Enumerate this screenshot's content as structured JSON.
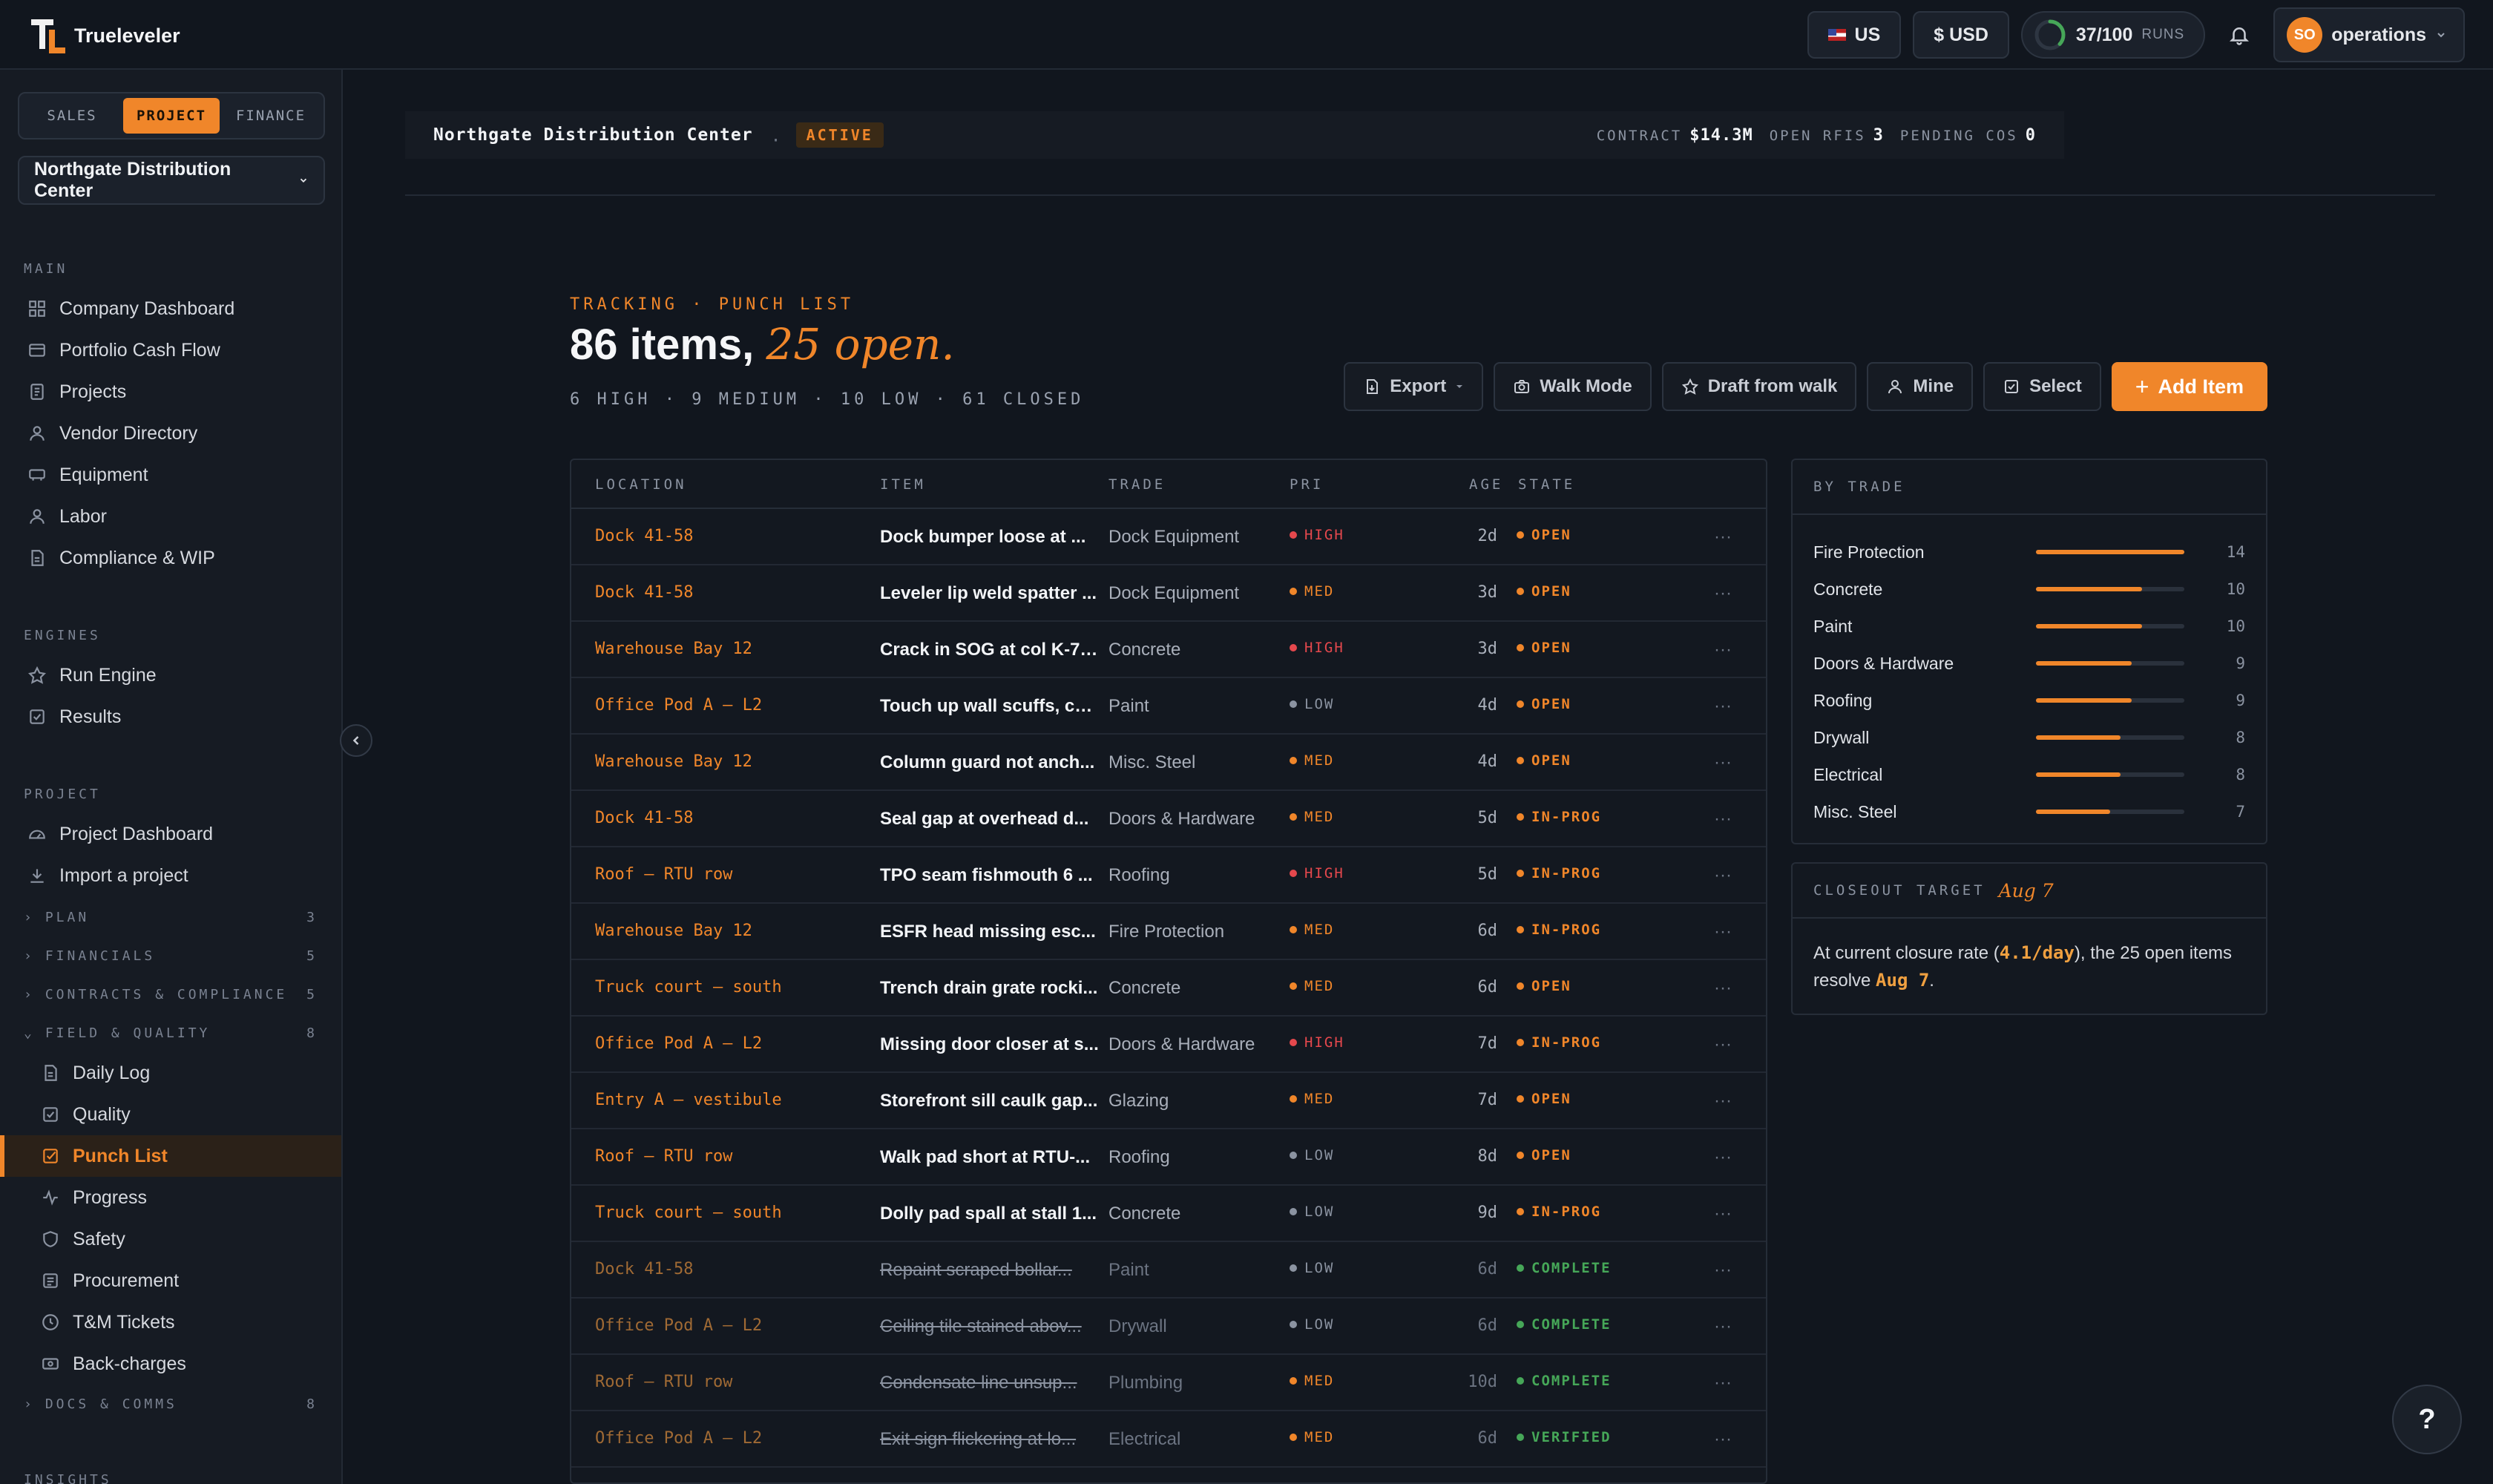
{
  "app": {
    "name": "Trueleveler"
  },
  "topbar": {
    "region": "US",
    "currency": "$ USD",
    "runs_count": "37/100",
    "runs_label": "RUNS",
    "runs_progress": 0.37,
    "user_initials": "SO",
    "user_name": "operations"
  },
  "sidebar": {
    "modes": [
      "SALES",
      "PROJECT",
      "FINANCE"
    ],
    "active_mode": "PROJECT",
    "project_selector": "Northgate Distribution Center",
    "main_title": "MAIN",
    "main": [
      "Company Dashboard",
      "Portfolio Cash Flow",
      "Projects",
      "Vendor Directory",
      "Equipment",
      "Labor",
      "Compliance & WIP"
    ],
    "engines_title": "ENGINES",
    "engines": [
      "Run Engine",
      "Results"
    ],
    "project_title": "PROJECT",
    "project": [
      "Project Dashboard",
      "Import a project"
    ],
    "groups": [
      {
        "label": "PLAN",
        "count": "3"
      },
      {
        "label": "FINANCIALS",
        "count": "5"
      },
      {
        "label": "CONTRACTS & COMPLIANCE",
        "count": "5"
      },
      {
        "label": "FIELD & QUALITY",
        "count": "8"
      }
    ],
    "field_items": [
      "Daily Log",
      "Quality",
      "Punch List",
      "Progress",
      "Safety",
      "Procurement",
      "T&M Tickets",
      "Back-charges"
    ],
    "docs_group": {
      "label": "DOCS & COMMS",
      "count": "8"
    },
    "insights_title": "INSIGHTS"
  },
  "header": {
    "project_name": "Northgate Distribution Center",
    "status": "ACTIVE",
    "contract_label": "CONTRACT",
    "contract_value": "$14.3M",
    "rfis_label": "OPEN RFIS",
    "rfis_value": "3",
    "cos_label": "PENDING COS",
    "cos_value": "0"
  },
  "page": {
    "eyebrow": "TRACKING · PUNCH LIST",
    "title_main": "86 items,",
    "title_accent": "25 open.",
    "summary": "6 HIGH · 9 MEDIUM · 10 LOW · 61 CLOSED"
  },
  "actions": {
    "export": "Export",
    "walk_mode": "Walk Mode",
    "draft": "Draft from walk",
    "mine": "Mine",
    "select": "Select",
    "add": "Add Item"
  },
  "table": {
    "columns": [
      "LOCATION",
      "ITEM",
      "TRADE",
      "PRI",
      "AGE",
      "STATE"
    ],
    "rows": [
      {
        "loc": "Dock 41-58",
        "item": "Dock bumper loose at ...",
        "trade": "Dock Equipment",
        "pri": "HIGH",
        "age": "2d",
        "state": "OPEN"
      },
      {
        "loc": "Dock 41-58",
        "item": "Leveler lip weld spatter ...",
        "trade": "Dock Equipment",
        "pri": "MED",
        "age": "3d",
        "state": "OPEN"
      },
      {
        "loc": "Warehouse Bay 12",
        "item": "Crack in SOG at col K-7 ...",
        "trade": "Concrete",
        "pri": "HIGH",
        "age": "3d",
        "state": "OPEN"
      },
      {
        "loc": "Office Pod A — L2",
        "item": "Touch up wall scuffs, co...",
        "trade": "Paint",
        "pri": "LOW",
        "age": "4d",
        "state": "OPEN"
      },
      {
        "loc": "Warehouse Bay 12",
        "item": "Column guard not anch...",
        "trade": "Misc. Steel",
        "pri": "MED",
        "age": "4d",
        "state": "OPEN"
      },
      {
        "loc": "Dock 41-58",
        "item": "Seal gap at overhead d...",
        "trade": "Doors & Hardware",
        "pri": "MED",
        "age": "5d",
        "state": "IN-PROG"
      },
      {
        "loc": "Roof — RTU row",
        "item": "TPO seam fishmouth 6 ...",
        "trade": "Roofing",
        "pri": "HIGH",
        "age": "5d",
        "state": "IN-PROG"
      },
      {
        "loc": "Warehouse Bay 12",
        "item": "ESFR head missing esc...",
        "trade": "Fire Protection",
        "pri": "MED",
        "age": "6d",
        "state": "IN-PROG"
      },
      {
        "loc": "Truck court — south",
        "item": "Trench drain grate rocki...",
        "trade": "Concrete",
        "pri": "MED",
        "age": "6d",
        "state": "OPEN"
      },
      {
        "loc": "Office Pod A — L2",
        "item": "Missing door closer at s...",
        "trade": "Doors & Hardware",
        "pri": "HIGH",
        "age": "7d",
        "state": "IN-PROG"
      },
      {
        "loc": "Entry A — vestibule",
        "item": "Storefront sill caulk gap...",
        "trade": "Glazing",
        "pri": "MED",
        "age": "7d",
        "state": "OPEN"
      },
      {
        "loc": "Roof — RTU row",
        "item": "Walk pad short at RTU-...",
        "trade": "Roofing",
        "pri": "LOW",
        "age": "8d",
        "state": "OPEN"
      },
      {
        "loc": "Truck court — south",
        "item": "Dolly pad spall at stall 1...",
        "trade": "Concrete",
        "pri": "LOW",
        "age": "9d",
        "state": "IN-PROG"
      },
      {
        "loc": "Dock 41-58",
        "item": "Repaint scraped bollar...",
        "trade": "Paint",
        "pri": "LOW",
        "age": "6d",
        "state": "COMPLETE"
      },
      {
        "loc": "Office Pod A — L2",
        "item": "Ceiling tile stained abov...",
        "trade": "Drywall",
        "pri": "LOW",
        "age": "6d",
        "state": "COMPLETE"
      },
      {
        "loc": "Roof — RTU row",
        "item": "Condensate line unsup...",
        "trade": "Plumbing",
        "pri": "MED",
        "age": "10d",
        "state": "COMPLETE"
      },
      {
        "loc": "Office Pod A — L2",
        "item": "Exit sign flickering at lo...",
        "trade": "Electrical",
        "pri": "MED",
        "age": "6d",
        "state": "VERIFIED"
      }
    ]
  },
  "by_trade": {
    "title": "BY TRADE",
    "max": 14,
    "items": [
      {
        "name": "Fire Protection",
        "count": 14
      },
      {
        "name": "Concrete",
        "count": 10
      },
      {
        "name": "Paint",
        "count": 10
      },
      {
        "name": "Doors & Hardware",
        "count": 9
      },
      {
        "name": "Roofing",
        "count": 9
      },
      {
        "name": "Drywall",
        "count": 8
      },
      {
        "name": "Electrical",
        "count": 8
      },
      {
        "name": "Misc. Steel",
        "count": 7
      }
    ]
  },
  "closeout": {
    "title": "CLOSEOUT TARGET",
    "date": "Aug 7",
    "text_a": "At current closure rate (",
    "rate": "4.1/day",
    "text_b": "), the 25 open items resolve ",
    "resolve_date": "Aug 7",
    "text_c": "."
  },
  "colors": {
    "accent": "#f0862a",
    "high": "#e5484d",
    "open": "#f0862a",
    "inprog": "#f0862a",
    "complete": "#46a758",
    "low": "#8b93a1"
  },
  "help": "?"
}
